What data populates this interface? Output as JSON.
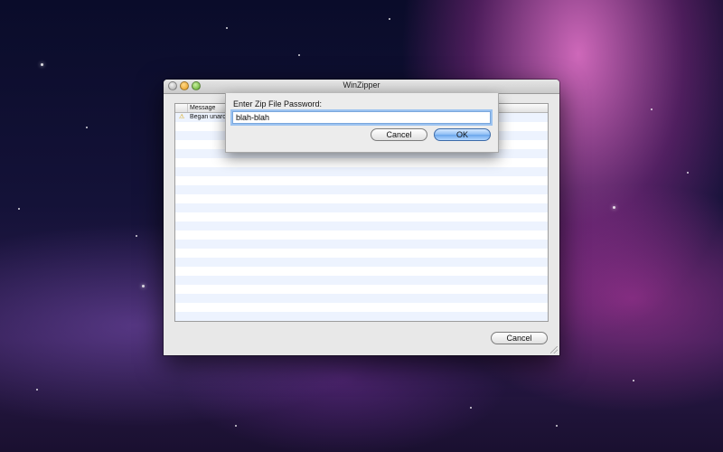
{
  "window": {
    "title": "WinZipper",
    "table": {
      "column_header": "Message",
      "rows": [
        {
          "icon": "warning-icon",
          "text": "Began unarc"
        }
      ],
      "empty_rows": 22
    },
    "cancel_label": "Cancel"
  },
  "dialog": {
    "label": "Enter Zip File Password:",
    "password_value": "blah-blah",
    "cancel_label": "Cancel",
    "ok_label": "OK"
  },
  "colors": {
    "stripe": "#edf3fe",
    "focus_ring": "#9cc3f0",
    "default_button": "#6aa6ec"
  }
}
